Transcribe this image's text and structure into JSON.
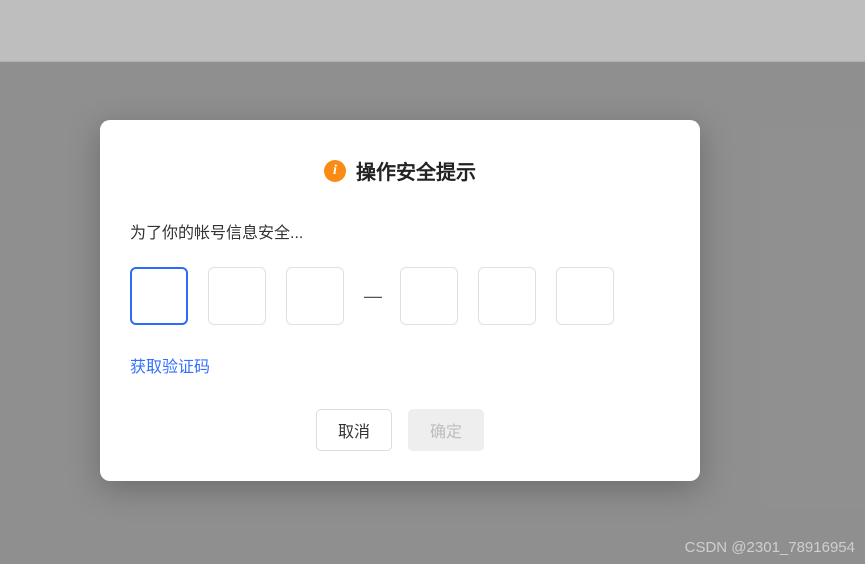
{
  "modal": {
    "title": "操作安全提示",
    "instruction": "为了你的帐号信息安全...",
    "info_icon_name": "info-icon",
    "code_separator": "—",
    "get_code_label": "获取验证码",
    "cancel_label": "取消",
    "confirm_label": "确定"
  },
  "watermark": "CSDN @2301_78916954"
}
